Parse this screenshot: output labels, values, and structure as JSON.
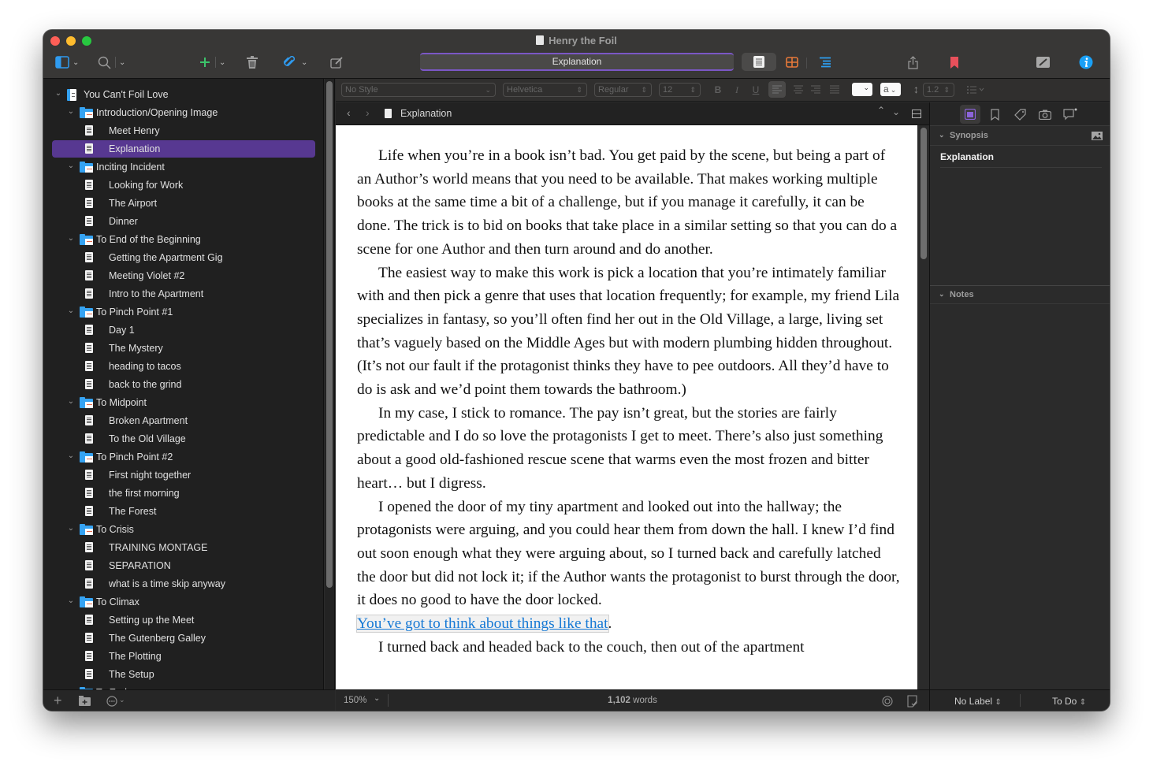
{
  "window": {
    "title": "Henry the Foil",
    "traffic_lights": [
      "close",
      "minimize",
      "zoom"
    ]
  },
  "toolbar": {
    "left_icons": [
      "sidebar-toggle-icon",
      "search-icon",
      "add-icon",
      "trash-icon",
      "attachment-icon",
      "compose-icon"
    ],
    "document_title": "Explanation",
    "view_modes": [
      "document-view-icon",
      "corkboard-icon",
      "outline-icon"
    ],
    "right_icons": [
      "share-icon",
      "bookmark-icon",
      "composition-mode-icon",
      "inspector-info-icon"
    ],
    "colors": {
      "add": "#3cc46b",
      "attachment": "#2f9bf0",
      "corkboard": "#e8793a",
      "outline": "#2d9ff2",
      "bookmark": "#e8505b",
      "info": "#1aa0f5",
      "selection": "#573891",
      "title_accent": "#7b57c6"
    }
  },
  "binder": {
    "items": [
      {
        "label": "You Can't Foil Love",
        "type": "project",
        "level": 0,
        "expanded": true
      },
      {
        "label": "Introduction/Opening Image",
        "type": "folder",
        "level": 1,
        "expanded": true
      },
      {
        "label": "Meet Henry",
        "type": "document",
        "level": 2
      },
      {
        "label": "Explanation",
        "type": "document",
        "level": 2,
        "selected": true
      },
      {
        "label": "Inciting Incident",
        "type": "folder",
        "level": 1,
        "expanded": true
      },
      {
        "label": "Looking for Work",
        "type": "document",
        "level": 2
      },
      {
        "label": "The Airport",
        "type": "document",
        "level": 2
      },
      {
        "label": "Dinner",
        "type": "document",
        "level": 2
      },
      {
        "label": "To End of the Beginning",
        "type": "folder",
        "level": 1,
        "expanded": true
      },
      {
        "label": "Getting the Apartment Gig",
        "type": "document",
        "level": 2
      },
      {
        "label": "Meeting Violet #2",
        "type": "document",
        "level": 2
      },
      {
        "label": "Intro to the Apartment",
        "type": "document",
        "level": 2
      },
      {
        "label": "To Pinch Point #1",
        "type": "folder",
        "level": 1,
        "expanded": true
      },
      {
        "label": "Day 1",
        "type": "document",
        "level": 2
      },
      {
        "label": "The Mystery",
        "type": "document",
        "level": 2
      },
      {
        "label": "heading to tacos",
        "type": "document",
        "level": 2
      },
      {
        "label": "back to the grind",
        "type": "document",
        "level": 2
      },
      {
        "label": "To Midpoint",
        "type": "folder",
        "level": 1,
        "expanded": true
      },
      {
        "label": "Broken Apartment",
        "type": "document",
        "level": 2
      },
      {
        "label": "To the Old Village",
        "type": "document",
        "level": 2
      },
      {
        "label": "To Pinch Point #2",
        "type": "folder",
        "level": 1,
        "expanded": true
      },
      {
        "label": "First night together",
        "type": "document",
        "level": 2
      },
      {
        "label": "the first morning",
        "type": "document",
        "level": 2
      },
      {
        "label": "The Forest",
        "type": "document",
        "level": 2
      },
      {
        "label": "To Crisis",
        "type": "folder",
        "level": 1,
        "expanded": true
      },
      {
        "label": "TRAINING MONTAGE",
        "type": "document",
        "level": 2
      },
      {
        "label": "SEPARATION",
        "type": "document",
        "level": 2
      },
      {
        "label": "what is a time skip anyway",
        "type": "document",
        "level": 2
      },
      {
        "label": "To Climax",
        "type": "folder",
        "level": 1,
        "expanded": true
      },
      {
        "label": "Setting up the Meet",
        "type": "document",
        "level": 2
      },
      {
        "label": "The Gutenberg Galley",
        "type": "document",
        "level": 2
      },
      {
        "label": "The Plotting",
        "type": "document",
        "level": 2
      },
      {
        "label": "The Setup",
        "type": "document",
        "level": 2
      },
      {
        "label": "To End",
        "type": "folder",
        "level": 1,
        "expanded": true
      }
    ],
    "footer_icons": [
      "add-icon",
      "add-folder-icon",
      "more-options-icon"
    ]
  },
  "format_bar": {
    "style": "No Style",
    "font": "Helvetica",
    "weight": "Regular",
    "size": "12",
    "bold": "B",
    "italic": "I",
    "underline": "U",
    "highlight_letter": "a",
    "line_spacing": "1.2"
  },
  "editor": {
    "header_title": "Explanation",
    "paragraphs": [
      "Life when you’re in a book isn’t bad. You get paid by the scene, but being a part of an Author’s world means that you need to be available. That makes working multiple books at the same time a bit of a challenge, but if you manage it carefully, it can be done. The trick is to bid on books that take place in a similar setting so that you can do a scene for one Author and then turn around and do another.",
      "The easiest way to make this work is pick a location that you’re intimately familiar with and then pick a genre that uses that location frequently; for example, my friend Lila specializes in fantasy, so you’ll often find her out in the Old Village, a large, living set that’s vaguely based on the Middle Ages but with modern plumbing hidden throughout. (It’s not our fault if the protagonist thinks they have to pee outdoors. All they’d have to do is ask and we’d point them towards the bathroom.)",
      "In my case, I stick to romance. The pay isn’t great, but the stories are fairly predictable and I do so love the protagonists I get to meet. There’s also just something about a good old-fashioned rescue scene that warms even the most frozen and bitter heart… but I digress.",
      "I opened the door of my tiny apartment and looked out into the hallway; the protagonists were arguing, and you could hear them from down the hall. I knew I’d find out soon enough what they were arguing about, so I turned back and carefully latched the door but did not lock it; if the Author wants the protagonist to burst through the door, it does no good to have the door locked."
    ],
    "link_text": "You’ve got to think about things like that",
    "link_trailing": ".",
    "next_paragraph_fragment": "I turned back and headed back to the couch, then out of the apartment",
    "zoom": "150%",
    "word_count": "1,102",
    "word_count_suffix": " words"
  },
  "inspector": {
    "tabs": [
      "notes-tab-icon",
      "bookmarks-tab-icon",
      "metadata-tab-icon",
      "snapshots-tab-icon",
      "comments-tab-icon"
    ],
    "synopsis_header": "Synopsis",
    "synopsis_text": "Explanation",
    "notes_header": "Notes",
    "label": "No Label",
    "status": "To Do"
  }
}
